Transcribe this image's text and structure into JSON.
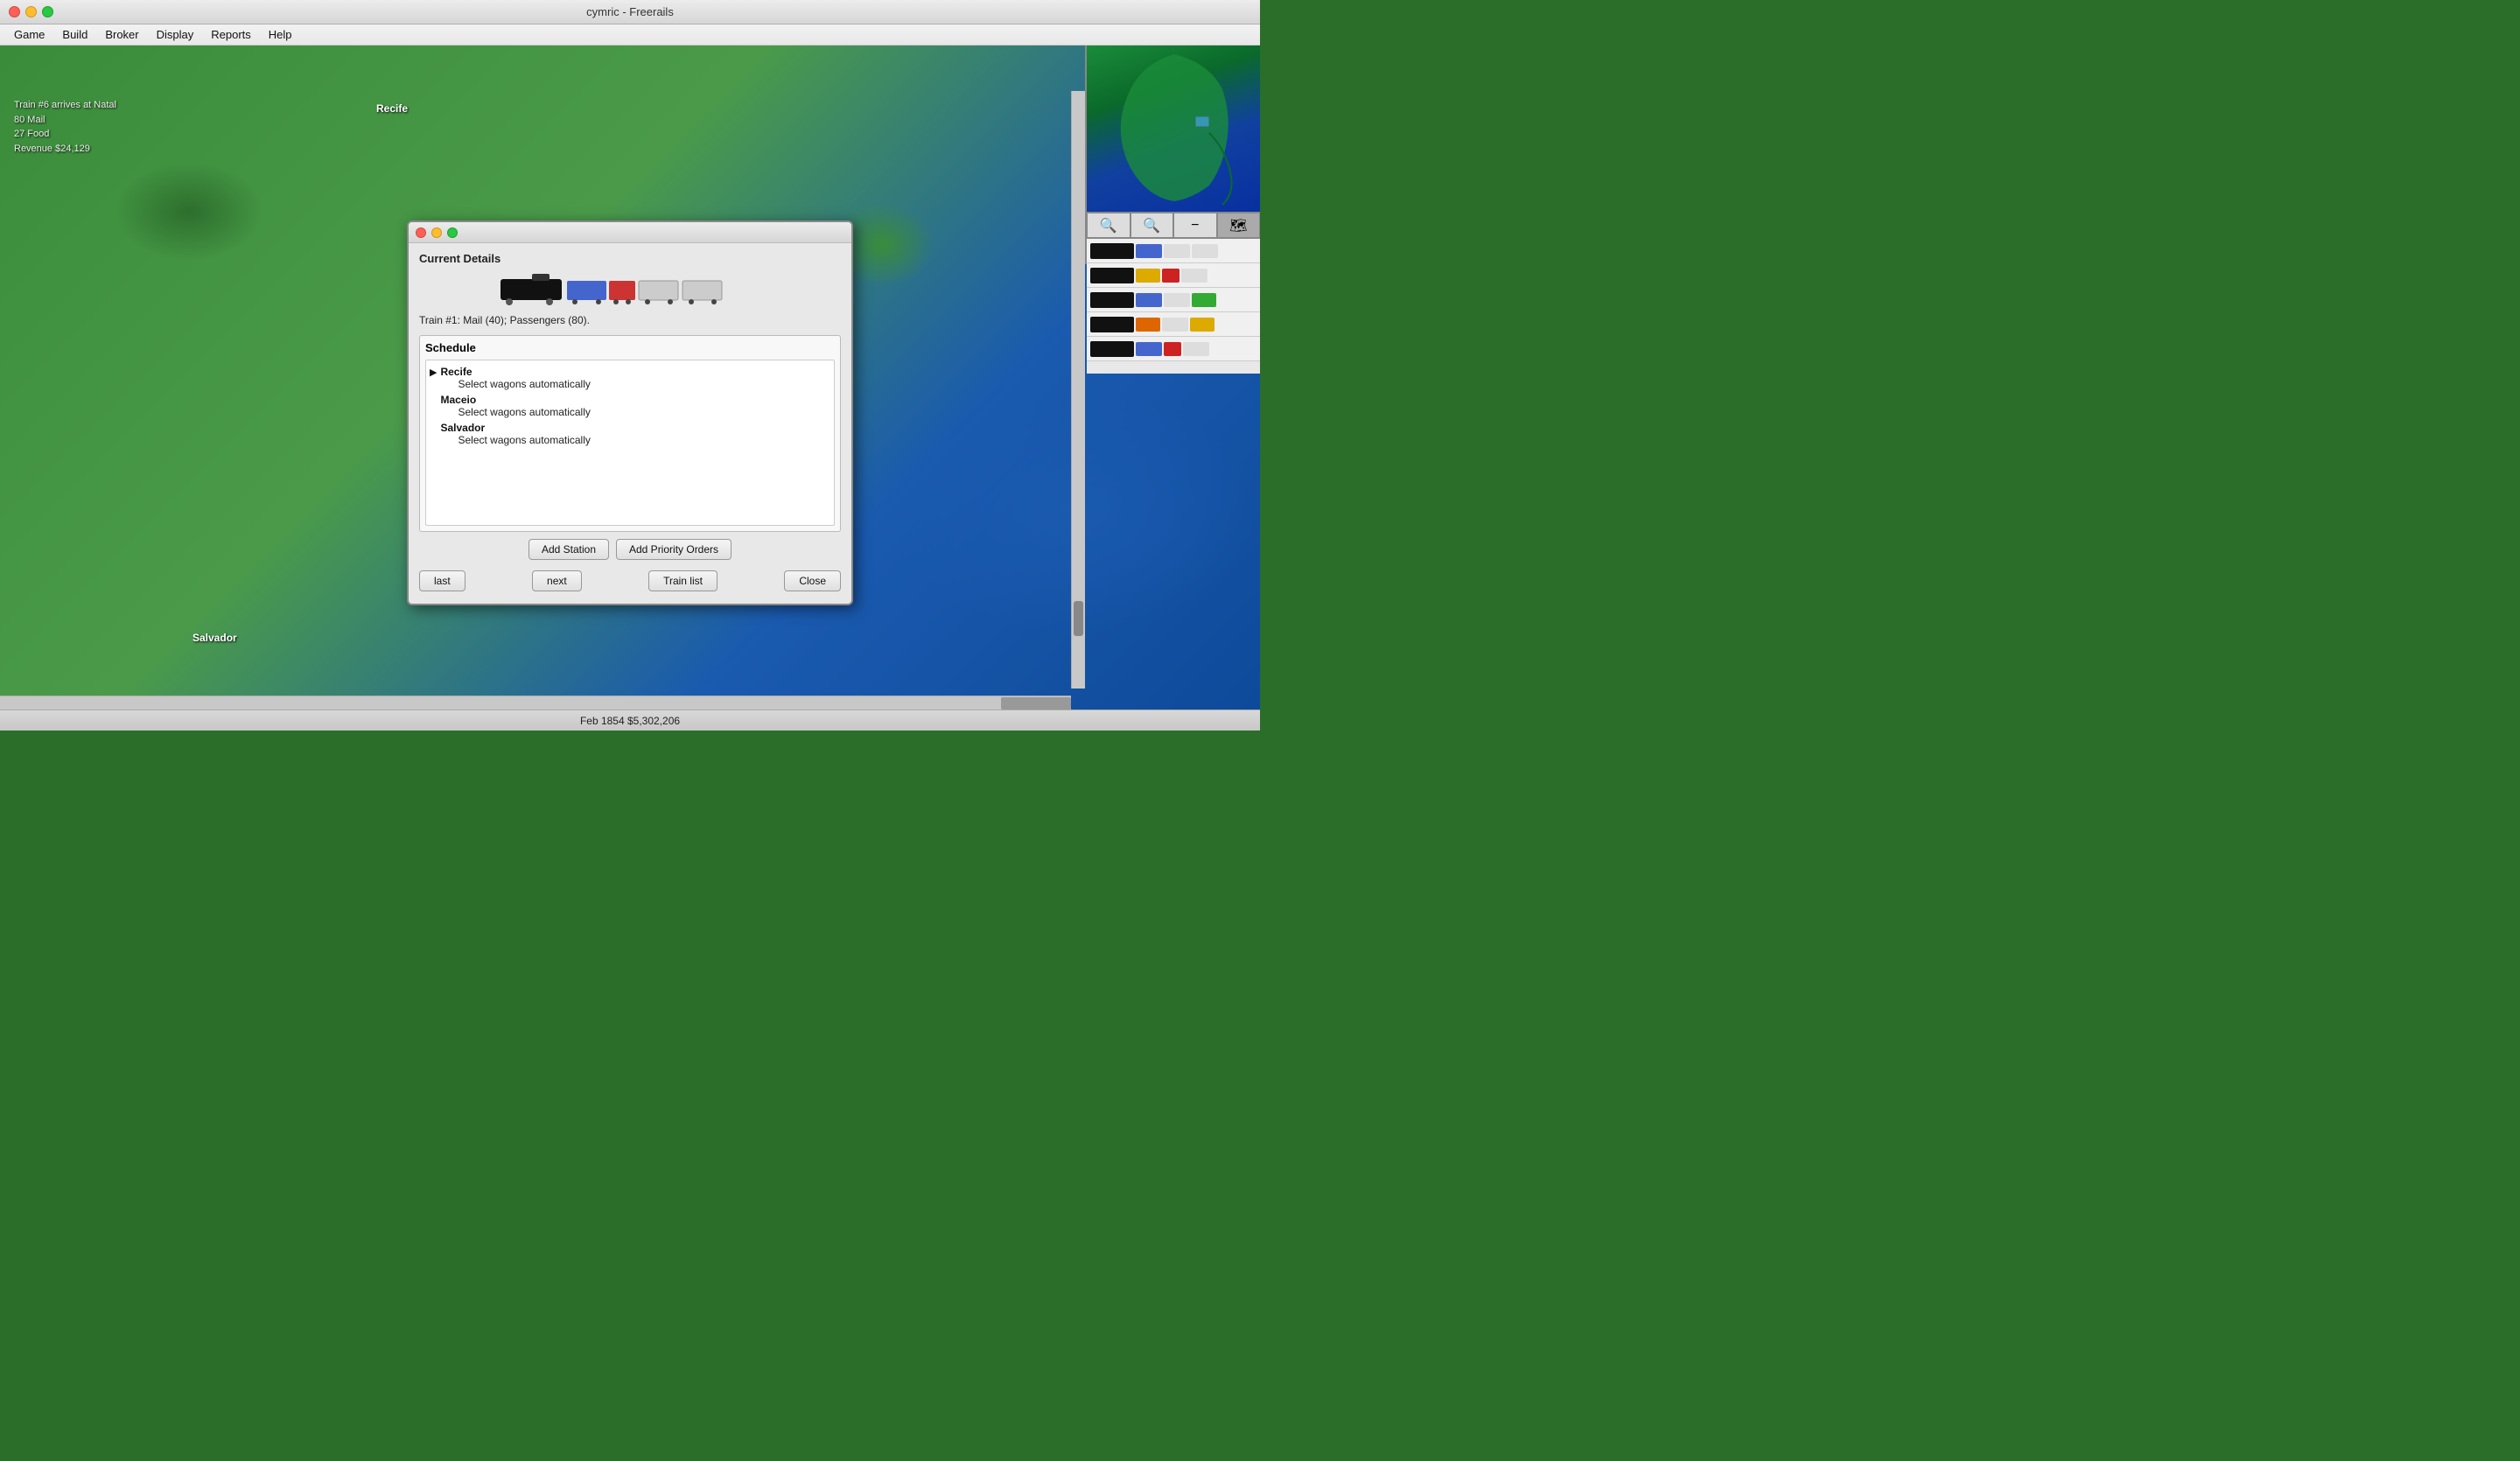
{
  "titlebar": {
    "title": "cymric - Freerails"
  },
  "menubar": {
    "items": [
      "Game",
      "Build",
      "Broker",
      "Display",
      "Reports",
      "Help"
    ]
  },
  "train_info": {
    "line1": "Train #6 arrives at Natal",
    "line2": "80 Mail",
    "line3": "27 Food",
    "line4": "Revenue $24,129"
  },
  "map": {
    "city_recife": "Recife",
    "city_salvador": "Salvador"
  },
  "dialog": {
    "section_title": "Current Details",
    "train_description": "Train #1: Mail (40); Passengers (80).",
    "schedule_title": "Schedule",
    "schedule": [
      {
        "station": "Recife",
        "instruction": "Select wagons automatically",
        "active": true
      },
      {
        "station": "Maceio",
        "instruction": "Select wagons automatically",
        "active": false
      },
      {
        "station": "Salvador",
        "instruction": "Select wagons automatically",
        "active": false
      }
    ],
    "buttons": {
      "add_station": "Add Station",
      "add_priority": "Add Priority Orders"
    },
    "nav": {
      "last": "last",
      "next": "next",
      "train_list": "Train list",
      "close": "Close"
    }
  },
  "statusbar": {
    "text": "Feb 1854  $5,302,206"
  },
  "minimap": {
    "controls": [
      "🔍",
      "🔍",
      "➖",
      "🗺"
    ]
  }
}
